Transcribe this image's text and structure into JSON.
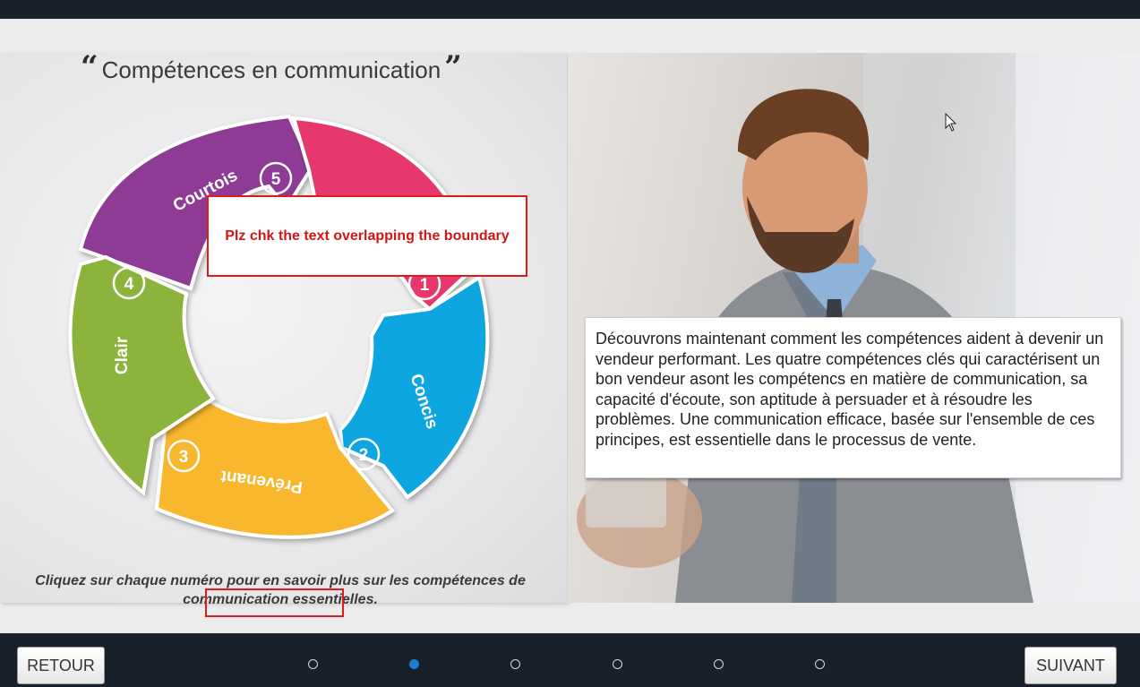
{
  "title": "Compétences en communication",
  "quote_open": "“",
  "quote_close": "”",
  "wheel": {
    "segments": [
      {
        "label": "Courtois",
        "number": "5",
        "color": "#8e3a96"
      },
      {
        "label": "",
        "number": "1",
        "color": "#e7396e"
      },
      {
        "label": "Concis",
        "number": "2",
        "color": "#0aa6e0"
      },
      {
        "label": "Prévenant",
        "number": "3",
        "color": "#f9b72f"
      },
      {
        "label": "Clair",
        "number": "4",
        "color": "#8cb43c"
      }
    ]
  },
  "instruction": "Cliquez sur chaque numéro pour en savoir plus sur les compétences de communication essentielles.",
  "body_text": "Découvrons maintenant comment les compétences aident à devenir un vendeur performant. Les quatre compétences clés qui caractérisent un bon vendeur asont les compétencs en matière de communication, sa capacité d'écoute, son aptitude à persuader et à résoudre les problèmes. Une communication efficace, basée sur l'ensemble de ces principes, est essentielle dans le processus de vente.",
  "review_note": "Plz chk the text overlapping the boundary",
  "nav": {
    "back_label": "RETOUR",
    "next_label": "SUIVANT",
    "dots": 6,
    "active_dot": 2
  },
  "colors": {
    "bar": "#17202b",
    "accent": "#1a7fd4",
    "note": "#e01a1a"
  }
}
